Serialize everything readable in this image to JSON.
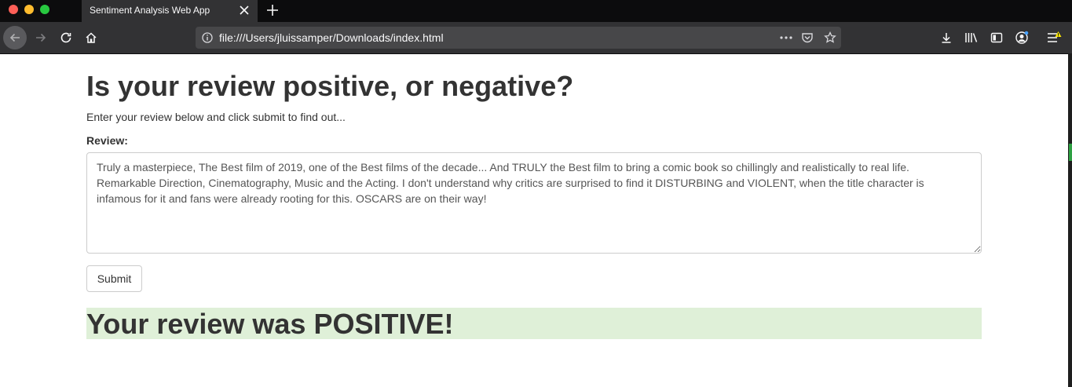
{
  "browser": {
    "tab_title": "Sentiment Analysis Web App",
    "url": "file:///Users/jluissamper/Downloads/index.html",
    "colors": {
      "chrome": "#0c0c0d",
      "toolbar": "#323234",
      "urlbar": "#474749",
      "icon": "#f9f9fa"
    }
  },
  "page": {
    "heading": "Is your review positive, or negative?",
    "subtitle": "Enter your review below and click submit to find out...",
    "review_label": "Review:",
    "review_text": "Truly a masterpiece, The Best film of 2019, one of the Best films of the decade... And TRULY the Best film to bring a comic book so chillingly and realistically to real life. Remarkable Direction, Cinematography, Music and the Acting. I don't understand why critics are surprised to find it DISTURBING and VIOLENT, when the title character is infamous for it and fans were already rooting for this. OSCARS are on their way!",
    "submit_label": "Submit",
    "result_text": "Your review was POSITIVE!",
    "result_color": "#dff0d8"
  }
}
